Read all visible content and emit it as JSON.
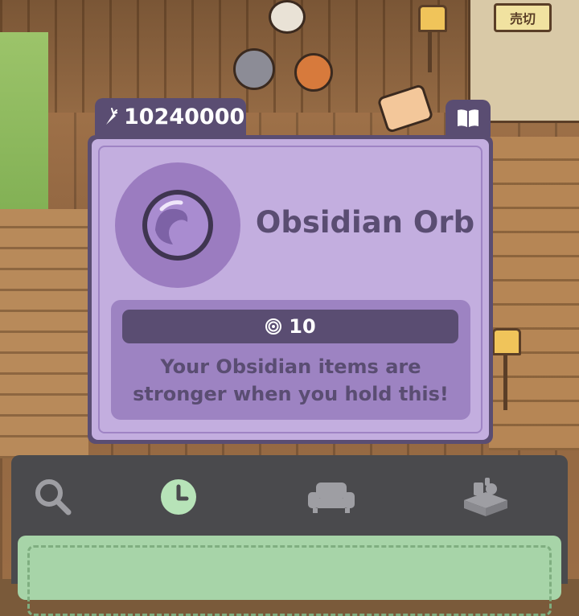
{
  "currency": {
    "icon": "carrot-icon",
    "amount": "10240000"
  },
  "top_actions": {
    "book_icon": "book-icon"
  },
  "background": {
    "sign_tag_text": "売切"
  },
  "item": {
    "name": "Obsidian Orb",
    "icon": "obsidian-orb-icon",
    "stat_icon": "spiral-icon",
    "stat_value": "10",
    "description_line1": "Your Obsidian items are",
    "description_line2": "stronger when you hold this!"
  },
  "toolbar": {
    "tabs": [
      {
        "icon": "magnifier-icon",
        "active": false
      },
      {
        "icon": "clock-icon",
        "active": true
      },
      {
        "icon": "sofa-icon",
        "active": false
      },
      {
        "icon": "items-box-icon",
        "active": false
      }
    ]
  },
  "colors": {
    "panel_dark": "#5a4d72",
    "card_light": "#c3aedf",
    "info_panel": "#9d83c2",
    "active_tab": "#b7e3b8",
    "inactive_tab": "#9e9ea3",
    "toolbar_bg": "#4a4a4d",
    "tray_bg": "#a7d4a8"
  }
}
